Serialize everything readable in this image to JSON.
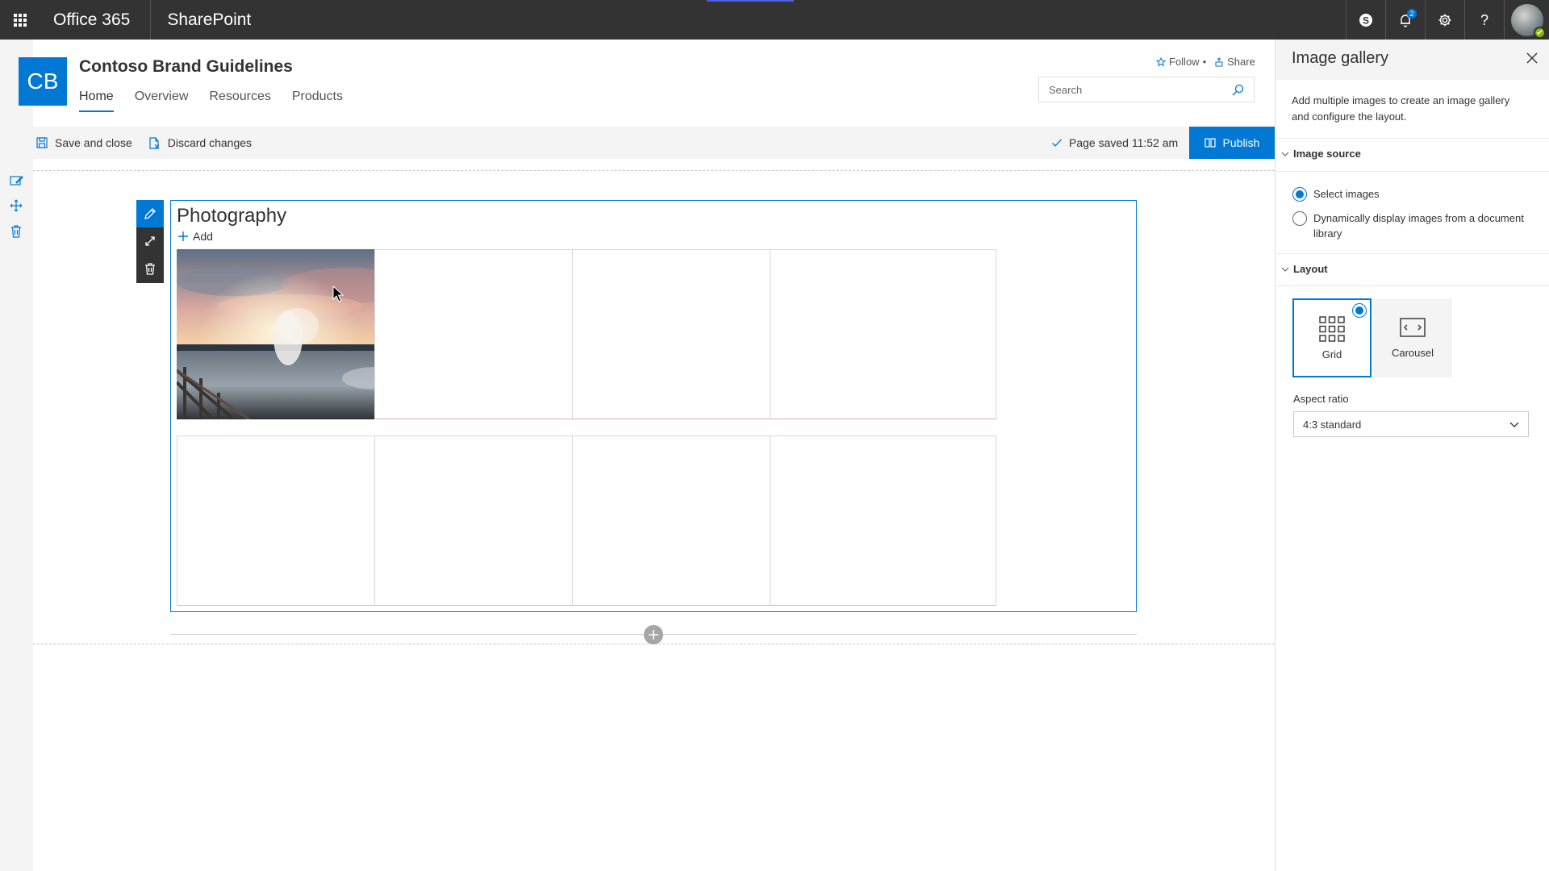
{
  "suite": {
    "product": "Office 365",
    "app": "SharePoint",
    "notification_count": "2",
    "icons": [
      "app-launcher-icon",
      "skype-icon",
      "bell-icon",
      "gear-icon",
      "help-icon",
      "avatar"
    ]
  },
  "site": {
    "logo_initials": "CB",
    "title": "Contoso Brand Guidelines",
    "nav": [
      {
        "label": "Home",
        "active": true
      },
      {
        "label": "Overview",
        "active": false
      },
      {
        "label": "Resources",
        "active": false
      },
      {
        "label": "Products",
        "active": false
      }
    ],
    "follow_label": "Follow",
    "share_label": "Share",
    "search_placeholder": "Search"
  },
  "commandbar": {
    "save_close_label": "Save and close",
    "discard_label": "Discard changes",
    "saved_status": "Page saved 11:52 am",
    "publish_label": "Publish"
  },
  "webpart": {
    "title": "Photography",
    "add_label": "Add",
    "grid_tiles": 8,
    "filled_tiles": 1
  },
  "pane": {
    "title": "Image gallery",
    "description": "Add multiple images to create an image gallery and configure the layout.",
    "image_source": {
      "heading": "Image source",
      "options": [
        {
          "label": "Select images",
          "selected": true
        },
        {
          "label": "Dynamically display images from a document library",
          "selected": false
        }
      ]
    },
    "layout": {
      "heading": "Layout",
      "options": [
        {
          "label": "Grid",
          "selected": true
        },
        {
          "label": "Carousel",
          "selected": false
        }
      ]
    },
    "aspect_ratio": {
      "label": "Aspect ratio",
      "value": "4:3 standard"
    }
  },
  "colors": {
    "accent": "#0078d4",
    "suitebar": "#333333",
    "presence": "#7fba00"
  }
}
